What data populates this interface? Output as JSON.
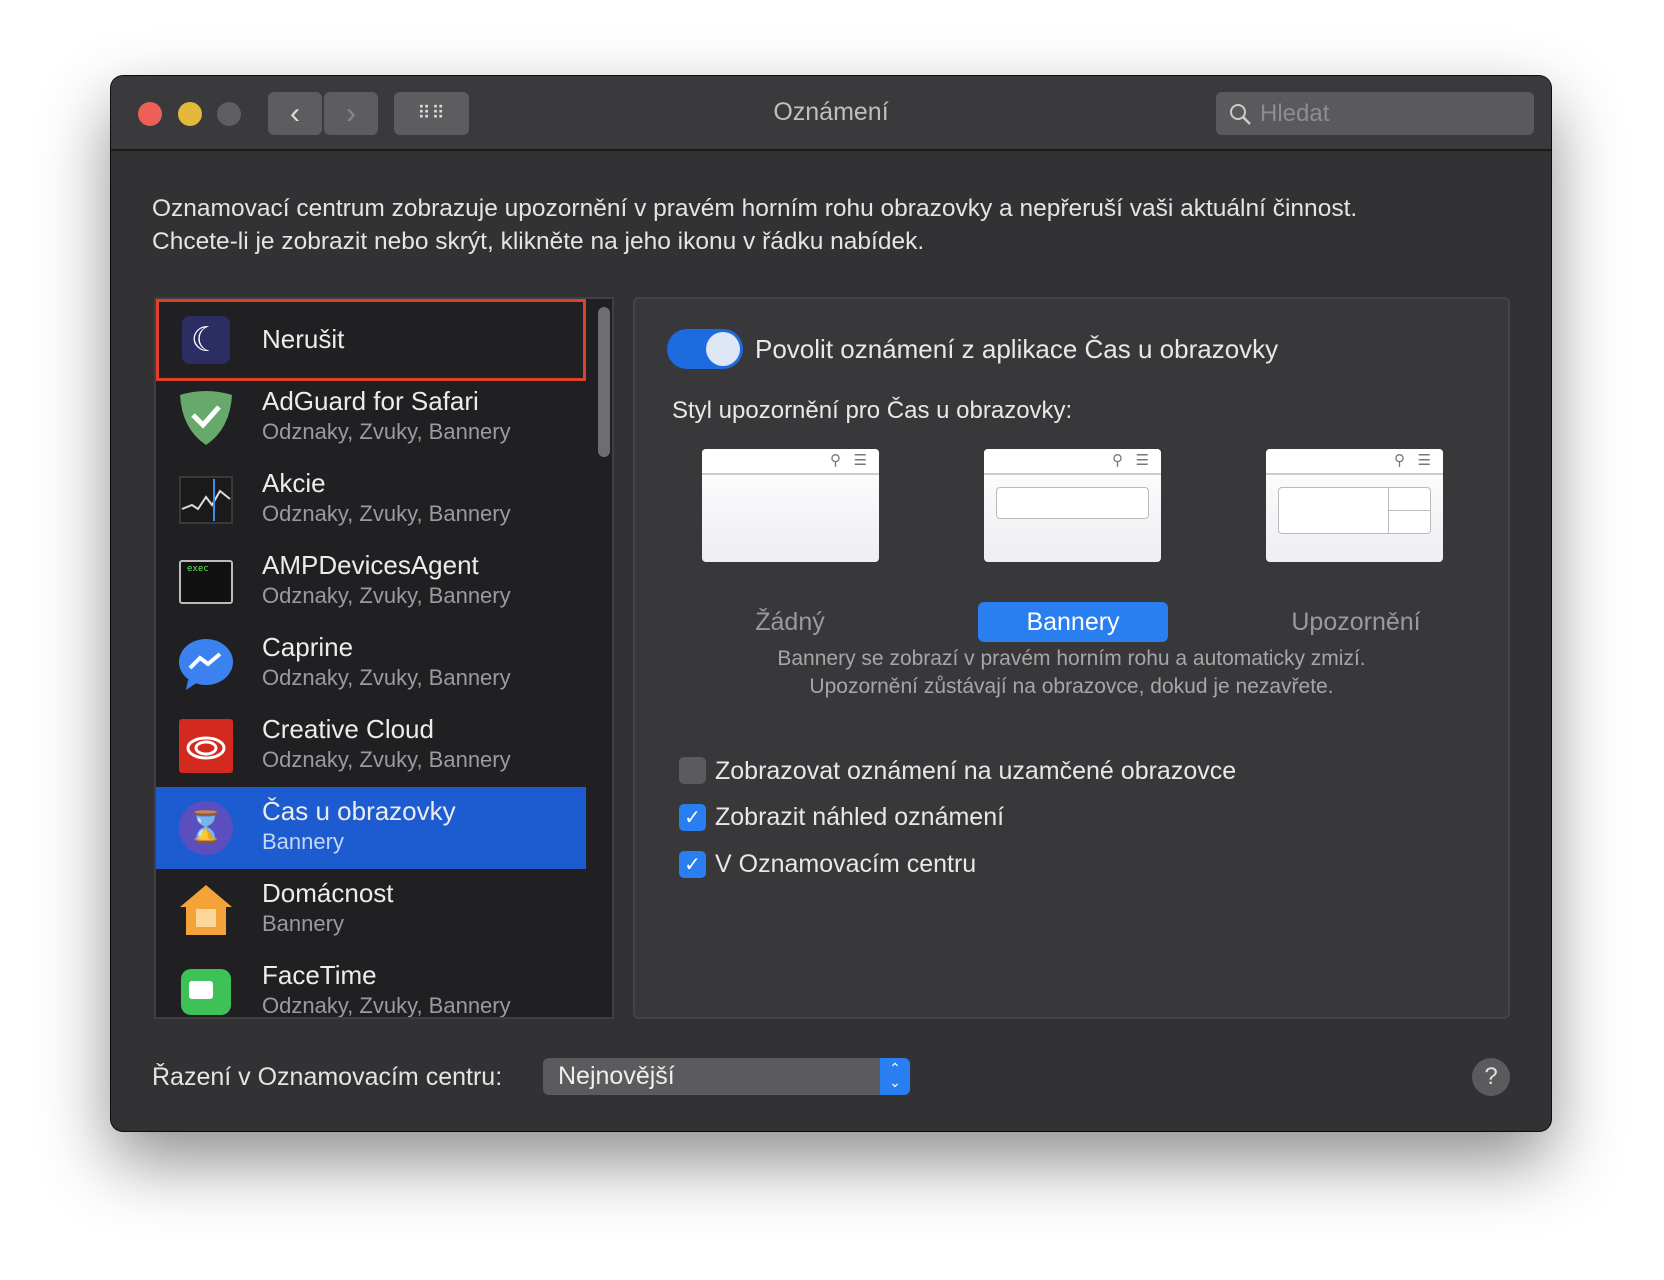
{
  "window": {
    "title": "Oznámení",
    "search_placeholder": "Hledat"
  },
  "description": [
    "Oznamovací centrum zobrazuje upozornění v pravém horním rohu obrazovky a nepřeruší vaši aktuální činnost.",
    "Chcete-li je zobrazit nebo skrýt, klikněte na jeho ikonu v řádku nabídek."
  ],
  "apps": [
    {
      "name": "Nerušit",
      "sub": ""
    },
    {
      "name": "AdGuard for Safari",
      "sub": "Odznaky, Zvuky, Bannery"
    },
    {
      "name": "Akcie",
      "sub": "Odznaky, Zvuky, Bannery"
    },
    {
      "name": "AMPDevicesAgent",
      "sub": "Odznaky, Zvuky, Bannery",
      "icon_text": "exec"
    },
    {
      "name": "Caprine",
      "sub": "Odznaky, Zvuky, Bannery"
    },
    {
      "name": "Creative Cloud",
      "sub": "Odznaky, Zvuky, Bannery"
    },
    {
      "name": "Čas u obrazovky",
      "sub": "Bannery"
    },
    {
      "name": "Domácnost",
      "sub": "Bannery"
    },
    {
      "name": "FaceTime",
      "sub": "Odznaky, Zvuky, Bannery"
    }
  ],
  "panel": {
    "allow_label": "Povolit oznámení z aplikace Čas u obrazovky",
    "allow_on": true,
    "style_label": "Styl upozornění pro Čas u obrazovky:",
    "styles": [
      "Žádný",
      "Bannery",
      "Upozornění"
    ],
    "selected_style": "Bannery",
    "hint": [
      "Bannery se zobrazí v pravém horním rohu a automaticky zmizí.",
      "Upozornění zůstávají na obrazovce, dokud je nezavřete."
    ],
    "options": [
      {
        "label": "Zobrazovat oznámení na uzamčené obrazovce",
        "checked": false
      },
      {
        "label": "Zobrazit náhled oznámení",
        "checked": true
      },
      {
        "label": "V Oznamovacím centru",
        "checked": true
      }
    ]
  },
  "sort": {
    "label": "Řazení v Oznamovacím centru:",
    "value": "Nejnovější"
  },
  "help": "?",
  "colors": {
    "accent": "#2a7ff0",
    "selected_row": "#1d5bd0",
    "highlight": "#e0402a"
  }
}
